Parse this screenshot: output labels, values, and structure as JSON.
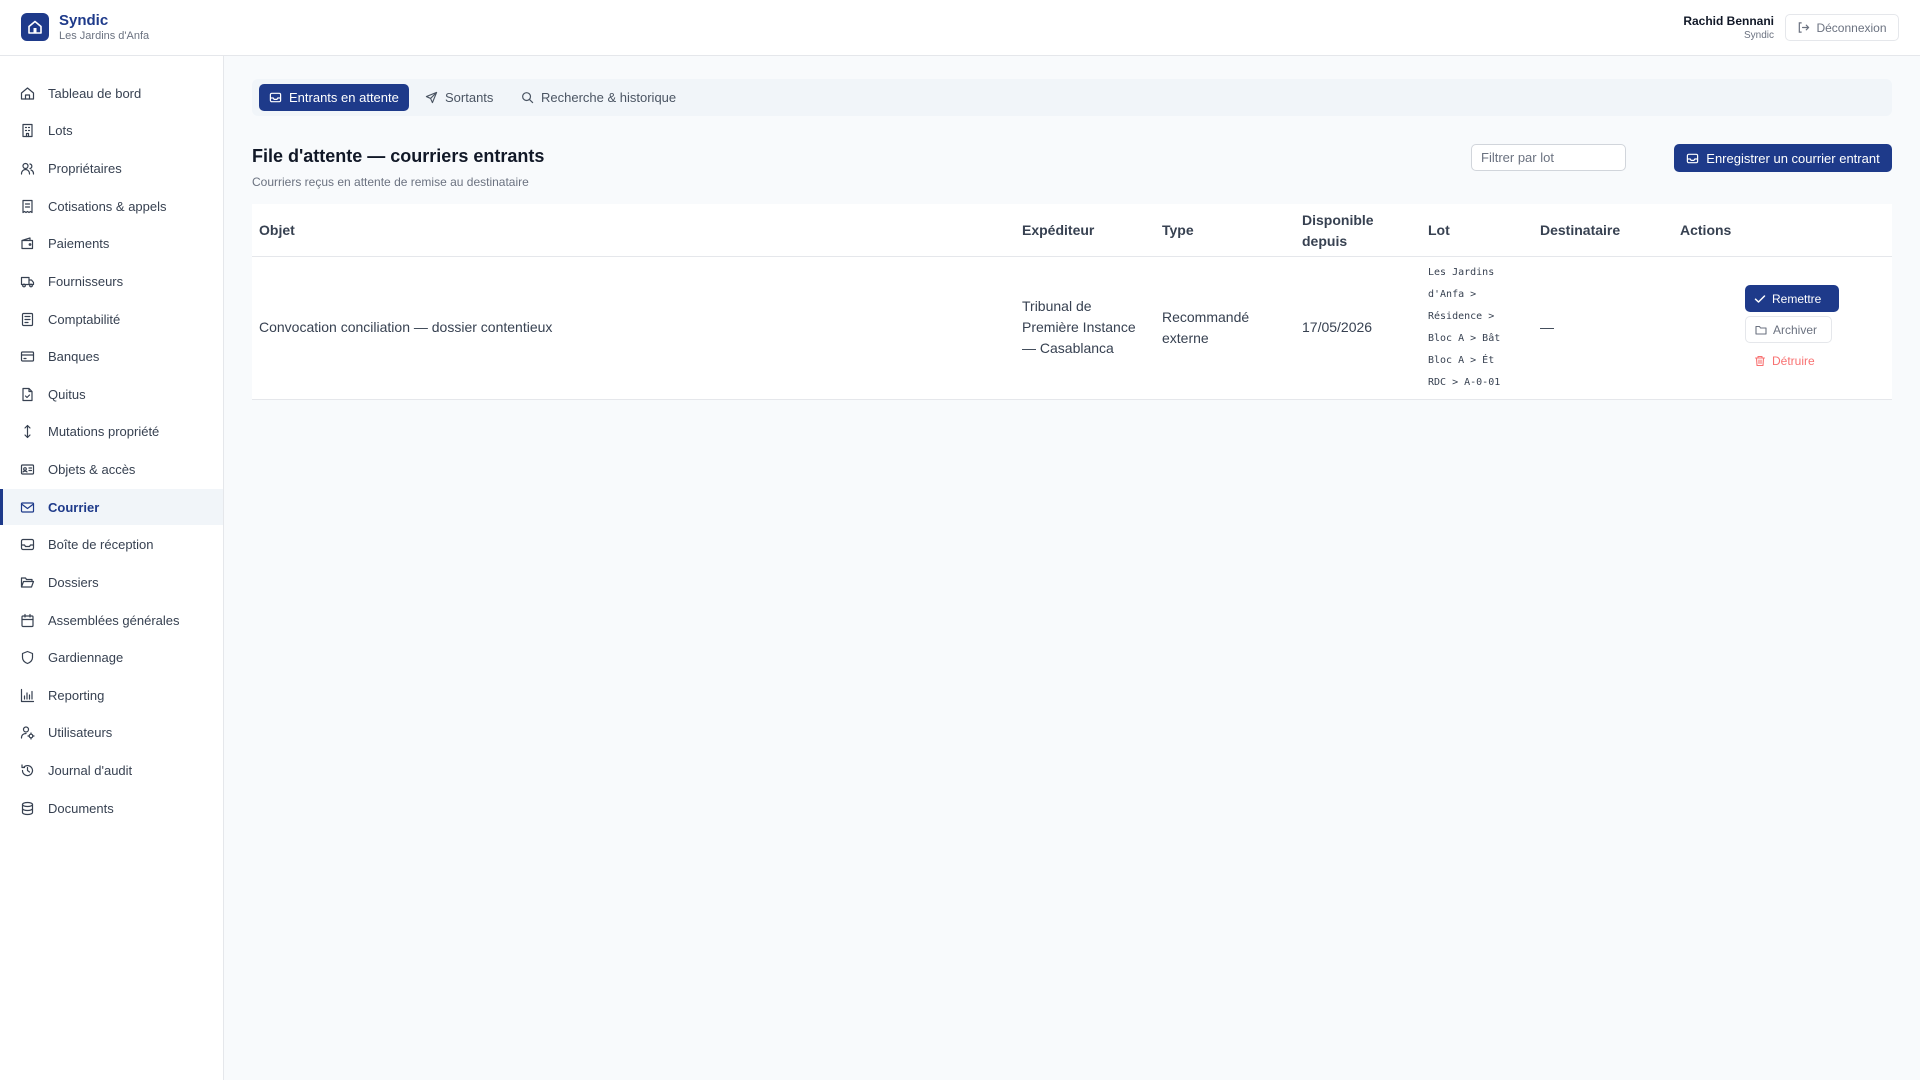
{
  "header": {
    "app_title": "Syndic",
    "residence": "Les Jardins d'Anfa",
    "user_name": "Rachid Bennani",
    "user_role": "Syndic",
    "logout_label": "Déconnexion"
  },
  "sidebar": {
    "items": [
      {
        "label": "Tableau de bord",
        "icon": "home-icon"
      },
      {
        "label": "Lots",
        "icon": "building-icon"
      },
      {
        "label": "Propriétaires",
        "icon": "users-icon"
      },
      {
        "label": "Cotisations & appels",
        "icon": "receipt-icon"
      },
      {
        "label": "Paiements",
        "icon": "wallet-icon"
      },
      {
        "label": "Fournisseurs",
        "icon": "truck-icon"
      },
      {
        "label": "Comptabilité",
        "icon": "ledger-icon"
      },
      {
        "label": "Banques",
        "icon": "credit-card-icon"
      },
      {
        "label": "Quitus",
        "icon": "file-check-icon"
      },
      {
        "label": "Mutations propriété",
        "icon": "arrows-vertical-icon"
      },
      {
        "label": "Objets & accès",
        "icon": "id-card-icon"
      },
      {
        "label": "Courrier",
        "icon": "mail-icon"
      },
      {
        "label": "Boîte de réception",
        "icon": "inbox-icon"
      },
      {
        "label": "Dossiers",
        "icon": "folder-open-icon"
      },
      {
        "label": "Assemblées générales",
        "icon": "calendar-icon"
      },
      {
        "label": "Gardiennage",
        "icon": "shield-icon"
      },
      {
        "label": "Reporting",
        "icon": "bar-chart-icon"
      },
      {
        "label": "Utilisateurs",
        "icon": "user-cog-icon"
      },
      {
        "label": "Journal d'audit",
        "icon": "history-icon"
      },
      {
        "label": "Documents",
        "icon": "database-icon"
      }
    ],
    "active": "Courrier"
  },
  "tabs": [
    {
      "label": "Entrants en attente",
      "icon": "inbox-icon",
      "active": true
    },
    {
      "label": "Sortants",
      "icon": "send-icon",
      "active": false
    },
    {
      "label": "Recherche & historique",
      "icon": "search-icon",
      "active": false
    }
  ],
  "section": {
    "title": "File d'attente — courriers entrants",
    "subtitle": "Courriers reçus en attente de remise au destinataire",
    "filter_placeholder": "Filtrer par lot",
    "primary_action": "Enregistrer un courrier entrant"
  },
  "table": {
    "columns": [
      "Objet",
      "Expéditeur",
      "Type",
      "Disponible depuis",
      "Lot",
      "Destinataire",
      "Actions"
    ],
    "rows": [
      {
        "objet": "Convocation conciliation — dossier contentieux",
        "expediteur": "Tribunal de Première Instance — Casablanca",
        "type": "Recommandé externe",
        "disponible_depuis": "17/05/2026",
        "lot": "Les Jardins d'Anfa > Résidence > Bloc A > Bât Bloc A > Ét RDC > A-0-01",
        "destinataire": "—",
        "actions": {
          "remettre": "Remettre",
          "archiver": "Archiver",
          "detruire": "Détruire"
        }
      }
    ]
  },
  "colors": {
    "primary": "#1e3a8a",
    "danger": "#f87171",
    "background": "#f8fafc"
  }
}
